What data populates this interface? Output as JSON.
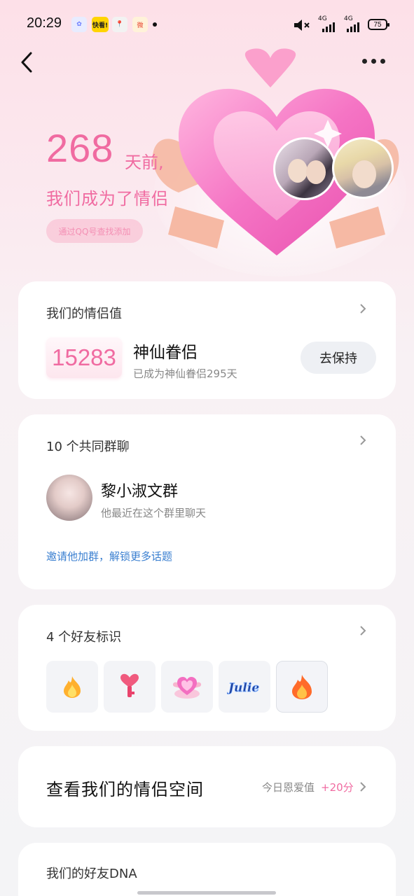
{
  "status_bar": {
    "time": "20:29",
    "notifications": [
      {
        "icon": "app-icon-blue",
        "text": "✿"
      },
      {
        "icon": "kuaikan-icon",
        "text": "快看!"
      },
      {
        "icon": "pin-icon",
        "text": "📍"
      },
      {
        "icon": "weibo-icon",
        "text": "微"
      }
    ],
    "signal_1": "4G",
    "signal_2": "4G",
    "battery": "75"
  },
  "hero": {
    "days": "268",
    "days_suffix": "天前,",
    "subtitle": "我们成为了情侣",
    "pill": "通过QQ号查找添加"
  },
  "couple_value_card": {
    "title": "我们的情侣值",
    "score": "15283",
    "level_name": "神仙眷侣",
    "level_desc": "已成为神仙眷侣295天",
    "button": "去保持"
  },
  "groups_card": {
    "title": "10 个共同群聊",
    "group_name": "黎小淑文群",
    "group_desc": "他最近在这个群里聊天",
    "invite": "邀请他加群，解锁更多话题"
  },
  "badges_card": {
    "title": "4 个好友标识",
    "badges": [
      {
        "icon": "flame-icon"
      },
      {
        "icon": "key-heart-icon"
      },
      {
        "icon": "heart-box-icon"
      },
      {
        "icon": "julie-badge-icon",
        "text": "Julie"
      },
      {
        "icon": "flame-icon"
      }
    ]
  },
  "space_card": {
    "title": "查看我们的情侣空间",
    "label": "今日恩爱值",
    "score": "+20分"
  },
  "dna_card": {
    "title": "我们的好友DNA"
  },
  "colors": {
    "accent": "#f06ba1",
    "link": "#3a7fd0"
  }
}
